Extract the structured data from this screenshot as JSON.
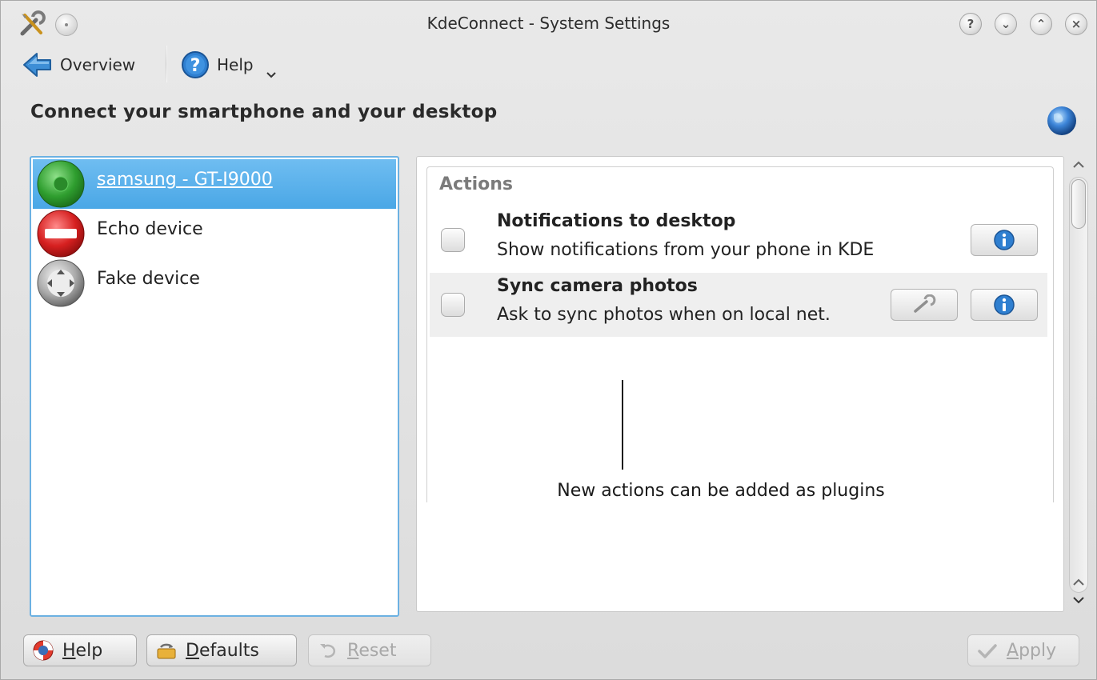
{
  "window": {
    "title": "KdeConnect - System Settings",
    "buttons": {
      "help": "?",
      "minimize": "⌄",
      "maximize": "⌃",
      "close": "×"
    }
  },
  "toolbar": {
    "overview_label": "Overview",
    "help_label": "Help"
  },
  "header": {
    "title": "Connect your smartphone and your desktop"
  },
  "devices": [
    {
      "name": "samsung - GT-I9000",
      "status": "connected",
      "selected": true
    },
    {
      "name": "Echo device",
      "status": "blocked",
      "selected": false
    },
    {
      "name": "Fake device",
      "status": "unknown",
      "selected": false
    }
  ],
  "actions": {
    "group_title": "Actions",
    "plugins": [
      {
        "name": "Notifications to desktop",
        "description": "Show notifications from your phone in KDE",
        "checked": false,
        "has_configure": false
      },
      {
        "name": "Sync camera photos",
        "description": "Ask to sync photos when on local net.",
        "checked": false,
        "has_configure": true
      }
    ],
    "callout": "New actions can be added as plugins"
  },
  "bottom_buttons": {
    "help": {
      "mnemonic": "H",
      "rest": "elp"
    },
    "defaults": {
      "mnemonic": "D",
      "rest": "efaults"
    },
    "reset": {
      "mnemonic": "R",
      "rest": "eset"
    },
    "apply": {
      "mnemonic": "A",
      "rest": "pply"
    }
  },
  "colors": {
    "selection": "#4aa7e6",
    "focus_border": "#6cb1e2",
    "connected": "#2f9e2f",
    "blocked": "#d62020"
  }
}
